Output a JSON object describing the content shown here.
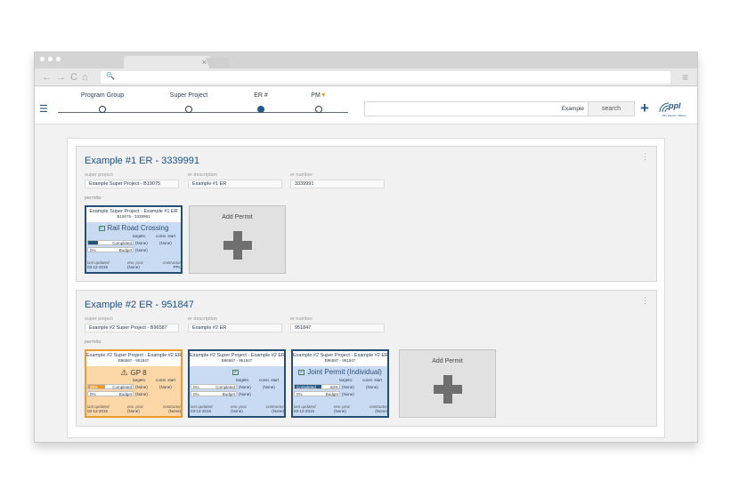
{
  "browser": {
    "menu_glyph": "≡",
    "back": "←",
    "forward": "→",
    "reload": "C",
    "home": "⌂",
    "tab_close": "×"
  },
  "header": {
    "steps": [
      {
        "label": "Program Group",
        "active": false
      },
      {
        "label": "Super Project",
        "active": false
      },
      {
        "label": "ER #",
        "active": true
      },
      {
        "label": "PM",
        "active": false
      }
    ],
    "search_value": "Example",
    "search_button": "search",
    "add_button": "+",
    "logo_text": "ppl",
    "logo_sub": "PPL Electric Utilities"
  },
  "field_labels": {
    "super_project": "super project",
    "er_description": "er description",
    "er_number": "er number",
    "permits": "permits:"
  },
  "permit_labels": {
    "targets": "targets:",
    "const_start": "const. start",
    "completed": "Completed",
    "budget": "Budget",
    "last_updated": "last updated",
    "env_proc": "env. proc",
    "contractor": "contractor"
  },
  "add_permit_label": "Add Permit",
  "ers": [
    {
      "title": "Example #1 ER - 3339991",
      "super_project": "Example Super Project - B19075",
      "er_description": "Example #1 ER",
      "er_number": "3339991",
      "permits": [
        {
          "title": "Example Super Project - Example #1 ER",
          "sub": "B19075 - 3339991",
          "name": "Rail Road Crossing",
          "status": "check",
          "completed_pct": "22%",
          "completed_fraction": 0.22,
          "completed_val": "(None)",
          "completed_val2": "(None)",
          "budget_pct": "0%",
          "budget_fraction": 0,
          "budget_val": "(None)",
          "last_updated": "03-12-2015",
          "env_proc": "(None)",
          "contractor": "PPL",
          "style": "blue"
        }
      ]
    },
    {
      "title": "Example #2 ER - 951847",
      "super_project": "Example #2 Super Project - B96587",
      "er_description": "Example #2 ER",
      "er_number": "951847",
      "permits": [
        {
          "title": "Example #2 Super Project - Example #2 ER",
          "sub": "B96587 - 951847",
          "name": "GP 8",
          "status": "warn",
          "completed_pct": "38%",
          "completed_fraction": 0.38,
          "completed_val": "(None)",
          "completed_val2": "(None)",
          "budget_pct": "0%",
          "budget_fraction": 0,
          "budget_val": "(None)",
          "last_updated": "03-12-2015",
          "env_proc": "(None)",
          "contractor": "(None)",
          "style": "orange"
        },
        {
          "title": "Example #2 Super Project - Example #2 ER",
          "sub": "B96587 - 951847",
          "name": "",
          "status": "check",
          "completed_pct": "0%",
          "completed_fraction": 0,
          "completed_val": "(None)",
          "completed_val2": "(None)",
          "budget_pct": "0%",
          "budget_fraction": 0,
          "budget_val": "(None)",
          "last_updated": "03-12-2015",
          "env_proc": "(None)",
          "contractor": "(None)",
          "style": "blue"
        },
        {
          "title": "Example #2 Super Project - Example #2 ER",
          "sub": "B96587 - 951847",
          "name": "Joint Permit (Individual)",
          "status": "check",
          "completed_pct": "60%",
          "completed_fraction": 0.6,
          "completed_val": "(None)",
          "completed_val2": "(None)",
          "budget_pct": "0%",
          "budget_fraction": 0,
          "budget_val": "(None)",
          "last_updated": "03-12-2015",
          "env_proc": "(None)",
          "contractor": "(None)",
          "style": "blue",
          "completed_label_in_bar": true
        }
      ]
    }
  ]
}
